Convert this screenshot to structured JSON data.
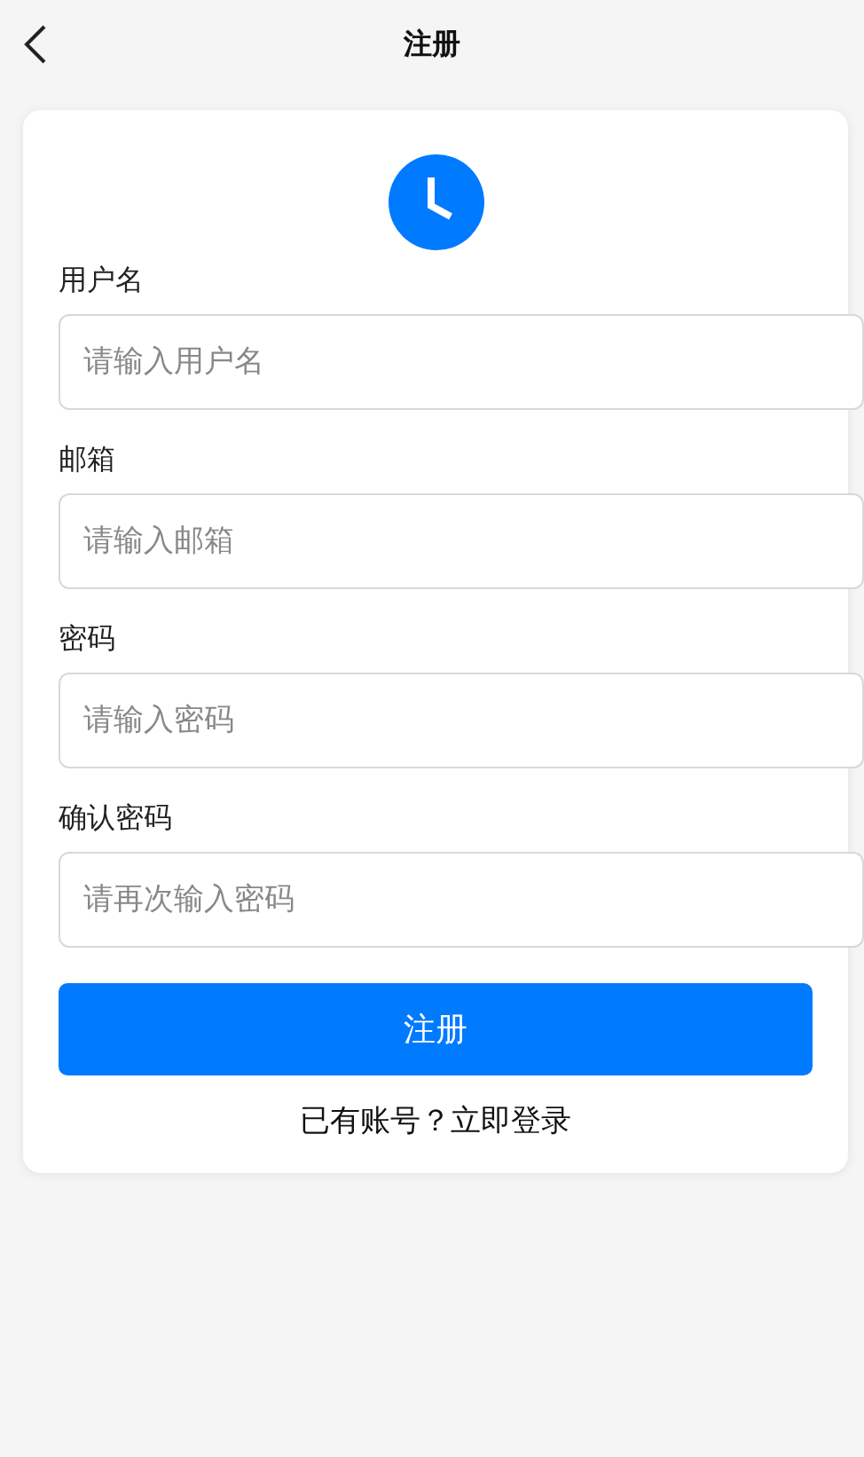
{
  "header": {
    "title": "注册"
  },
  "fields": [
    {
      "label": "用户名",
      "placeholder": "请输入用户名"
    },
    {
      "label": "邮箱",
      "placeholder": "请输入邮箱"
    },
    {
      "label": "密码",
      "placeholder": "请输入密码"
    },
    {
      "label": "确认密码",
      "placeholder": "请再次输入密码"
    }
  ],
  "submit_button": "注册",
  "login_link": "已有账号？立即登录"
}
